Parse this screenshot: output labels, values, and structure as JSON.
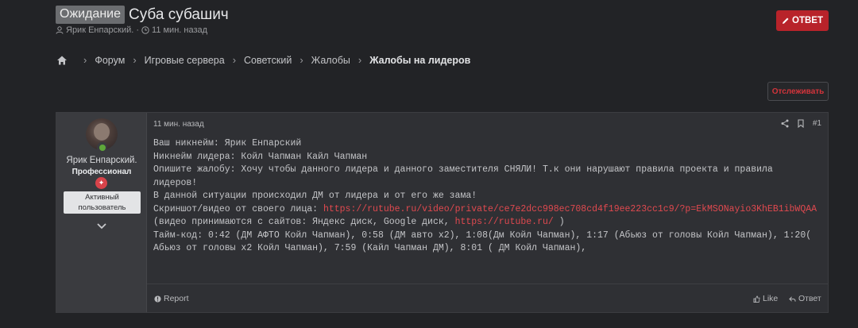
{
  "thread": {
    "prefix": "Ожидание",
    "title": "Суба субашич",
    "author": "Ярик Енпарский.",
    "separator": "·",
    "time": "11 мин. назад"
  },
  "reply_button_label": "ОТВЕТ",
  "breadcrumb": [
    "Форум",
    "Игровые сервера",
    "Советский",
    "Жалобы",
    "Жалобы на лидеров"
  ],
  "watch_button_label": "Отслеживать",
  "post": {
    "user": {
      "name": "Ярик Енпарский.",
      "title": "Профессионал",
      "banner": "Активный пользователь"
    },
    "date": "11 мин. назад",
    "number": "#1",
    "lines": {
      "l1": "Ваш никнейм: Ярик Енпарский",
      "l2": "Никнейм лидера: Койл Чапман Кайл Чапман",
      "l3": "Опишите жалобу: Хочу чтобы данного лидера и данного заместителя СНЯЛИ! Т.к они нарушают правила проекта и правила лидеров!",
      "l4": "В данной ситуации происходил ДМ от лидера и от его же зама!",
      "l5_label": "Скриншот/видео от своего лица: ",
      "l5_link": "https://rutube.ru/video/private/ce7e2dcc998ec708cd4f19ee223cc1c9/?p=EkMSONayio3KhEB1ibWQAA",
      "l6_pre": "(видео принимаются с сайтов: Яндекс диск, Google диск, ",
      "l6_link": "https://rutube.ru/",
      "l6_post": " )",
      "l7": "Тайм-код: 0:42 (ДМ АФТО Койл Чапман), 0:58 (ДМ авто х2), 1:08(Дм Койл Чапман), 1:17 (Абьюз от головы Койл Чапман), 1:20( Абьюз от головы х2 Койл Чапман), 7:59 (Кайл Чапман ДМ), 8:01 ( ДМ Койл Чапман),"
    },
    "footer": {
      "report": "Report",
      "like": "Like",
      "reply": "Ответ"
    }
  },
  "colors": {
    "background": "#222326",
    "accent_red": "#b8232a",
    "link": "#e0494f",
    "online": "#5fa83a"
  },
  "icons": [
    "user-icon",
    "clock-icon",
    "pencil-icon",
    "home-icon",
    "chevron-right-icon",
    "share-icon",
    "bookmark-icon",
    "chevron-down-icon",
    "report-icon",
    "like-icon",
    "reply-icon"
  ]
}
